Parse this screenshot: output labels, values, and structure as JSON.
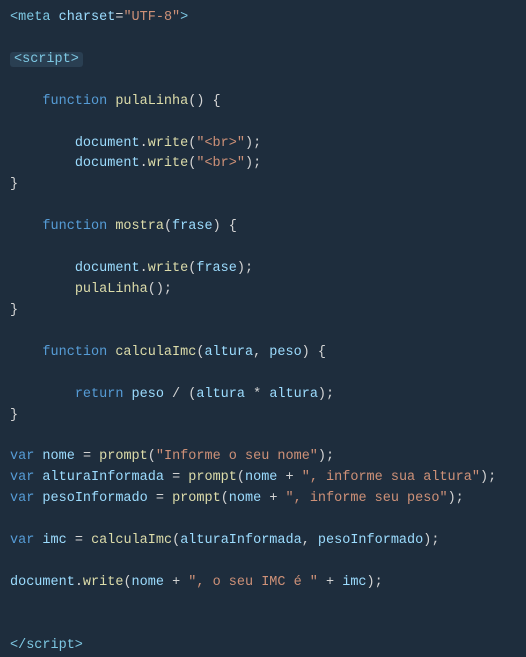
{
  "lines": [
    {
      "id": "meta-tag",
      "type": "meta"
    },
    {
      "id": "blank1",
      "type": "blank"
    },
    {
      "id": "script-open",
      "type": "script-open"
    },
    {
      "id": "blank2",
      "type": "blank"
    },
    {
      "id": "fn1-decl",
      "type": "fn1-decl"
    },
    {
      "id": "blank3",
      "type": "blank"
    },
    {
      "id": "fn1-doc1",
      "type": "fn1-doc1"
    },
    {
      "id": "fn1-doc2",
      "type": "fn1-doc2"
    },
    {
      "id": "fn1-close",
      "type": "fn1-close"
    },
    {
      "id": "blank4",
      "type": "blank"
    },
    {
      "id": "fn2-decl",
      "type": "fn2-decl"
    },
    {
      "id": "blank5",
      "type": "blank"
    },
    {
      "id": "fn2-body1",
      "type": "fn2-body1"
    },
    {
      "id": "fn2-body2",
      "type": "fn2-body2"
    },
    {
      "id": "fn2-close",
      "type": "fn2-close"
    },
    {
      "id": "blank6",
      "type": "blank"
    },
    {
      "id": "fn3-decl",
      "type": "fn3-decl"
    },
    {
      "id": "blank7",
      "type": "blank"
    },
    {
      "id": "fn3-body1",
      "type": "fn3-body1"
    },
    {
      "id": "fn3-close",
      "type": "fn3-close"
    },
    {
      "id": "blank8",
      "type": "blank"
    },
    {
      "id": "var1",
      "type": "var1"
    },
    {
      "id": "var2",
      "type": "var2"
    },
    {
      "id": "var3",
      "type": "var3"
    },
    {
      "id": "blank9",
      "type": "blank"
    },
    {
      "id": "var4",
      "type": "var4"
    },
    {
      "id": "blank10",
      "type": "blank"
    },
    {
      "id": "docwrite",
      "type": "docwrite"
    },
    {
      "id": "blank11",
      "type": "blank"
    },
    {
      "id": "blank12",
      "type": "blank"
    },
    {
      "id": "script-close",
      "type": "script-close"
    }
  ]
}
